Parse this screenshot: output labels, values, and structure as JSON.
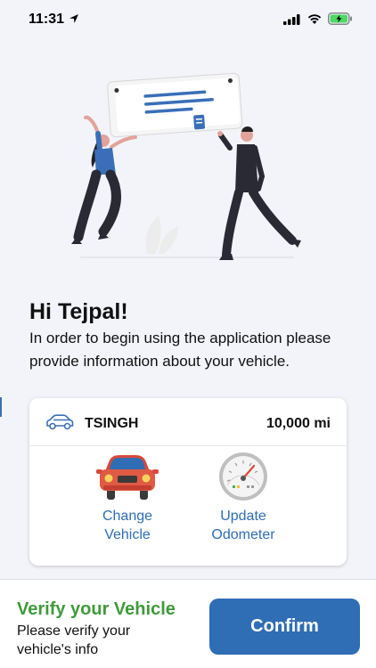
{
  "status_bar": {
    "time": "11:31"
  },
  "greeting": "Hi Tejpal!",
  "intro_text": "In order to begin using the application please provide information about your vehicle.",
  "vehicle_card": {
    "vehicle_name": "TSINGH",
    "odometer": "10,000 mi",
    "actions": [
      {
        "label": "Change\nVehicle",
        "icon": "red-car-icon"
      },
      {
        "label": "Update\nOdometer",
        "icon": "speedometer-icon"
      }
    ]
  },
  "bottom": {
    "title": "Verify your Vehicle",
    "description": "Please verify your vehicle's info",
    "confirm_label": "Confirm"
  },
  "colors": {
    "accent_blue": "#2f6db5",
    "verify_green": "#3f9a3b",
    "background": "#f2f4f9",
    "battery_green": "#4cd964"
  }
}
